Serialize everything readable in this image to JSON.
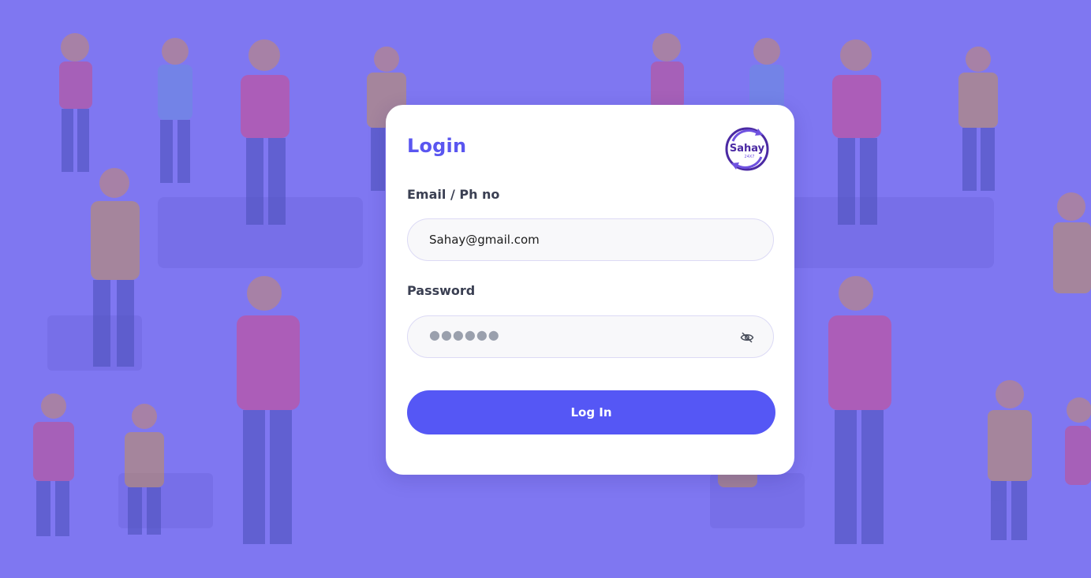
{
  "login": {
    "title": "Login",
    "logo_text": "Sahay",
    "logo_subtext": "24X7",
    "email_label": "Email / Ph no",
    "email_value": "Sahay@gmail.com",
    "password_label": "Password",
    "password_mask": "●●●●●●",
    "submit_label": "Log In"
  },
  "icons": {
    "password_toggle": "eye-off-icon",
    "logo": "sahay-logo-icon"
  },
  "colors": {
    "background": "#7f77f1",
    "accent": "#5a56f0",
    "button": "#5557f5"
  }
}
